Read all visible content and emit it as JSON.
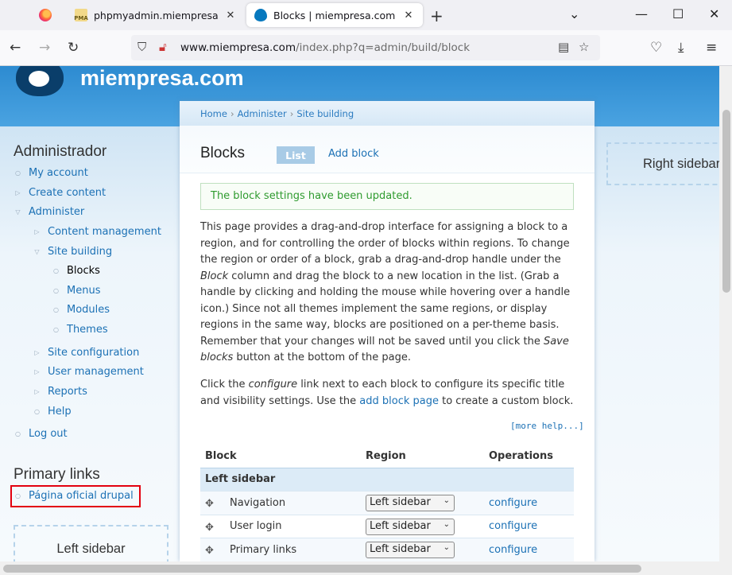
{
  "browser": {
    "tabs": [
      {
        "title": "phpmyadmin.miempresa.com /",
        "favicon": "PMA"
      },
      {
        "title": "Blocks | miempresa.com",
        "active": true
      }
    ],
    "url_domain": "www.miempresa.com",
    "url_path": "/index.php?q=admin/build/block"
  },
  "site": {
    "name": "miempresa.com"
  },
  "sidebar": {
    "admin_title": "Administrador",
    "items": [
      {
        "label": "My account",
        "bullet": "○"
      },
      {
        "label": "Create content",
        "bullet": "▷"
      },
      {
        "label": "Administer",
        "bullet": "▽"
      },
      {
        "label": "Content management",
        "bullet": "▷"
      },
      {
        "label": "Site building",
        "bullet": "▽"
      },
      {
        "label": "Blocks",
        "bullet": "○"
      },
      {
        "label": "Menus",
        "bullet": "○"
      },
      {
        "label": "Modules",
        "bullet": "○"
      },
      {
        "label": "Themes",
        "bullet": "○"
      },
      {
        "label": "Site configuration",
        "bullet": "▷"
      },
      {
        "label": "User management",
        "bullet": "▷"
      },
      {
        "label": "Reports",
        "bullet": "▷"
      },
      {
        "label": "Help",
        "bullet": "○"
      },
      {
        "label": "Log out",
        "bullet": "○"
      }
    ],
    "primary_links_title": "Primary links",
    "primary_link": "Página oficial drupal",
    "left_region_label": "Left sidebar"
  },
  "breadcrumb": [
    "Home",
    "Administer",
    "Site building"
  ],
  "main": {
    "title": "Blocks",
    "tab_list": "List",
    "tab_add": "Add block",
    "message": "The block settings have been updated.",
    "para1_a": "This page provides a drag-and-drop interface for assigning a block to a region, and for controlling the order of blocks within regions. To change the region or order of a block, grab a drag-and-drop handle under the ",
    "para1_em1": "Block",
    "para1_b": " column and drag the block to a new location in the list. (Grab a handle by clicking and holding the mouse while hovering over a handle icon.) Since not all themes implement the same regions, or display regions in the same way, blocks are positioned on a per-theme basis. Remember that your changes will not be saved until you click the ",
    "para1_em2": "Save blocks",
    "para1_c": " button at the bottom of the page.",
    "para2_a": "Click the ",
    "para2_em": "configure",
    "para2_b": " link next to each block to configure its specific title and visibility settings. Use the ",
    "para2_link": "add block page",
    "para2_c": " to create a custom block.",
    "more_help": "[more help...]"
  },
  "table": {
    "headers": [
      "Block",
      "Region",
      "Operations"
    ],
    "region_row": "Left sidebar",
    "rows": [
      {
        "block": "Navigation",
        "region": "Left sidebar",
        "op": "configure"
      },
      {
        "block": "User login",
        "region": "Left sidebar",
        "op": "configure"
      },
      {
        "block": "Primary links",
        "region": "Left sidebar",
        "op": "configure"
      }
    ]
  },
  "right_region_label": "Right sidebar"
}
